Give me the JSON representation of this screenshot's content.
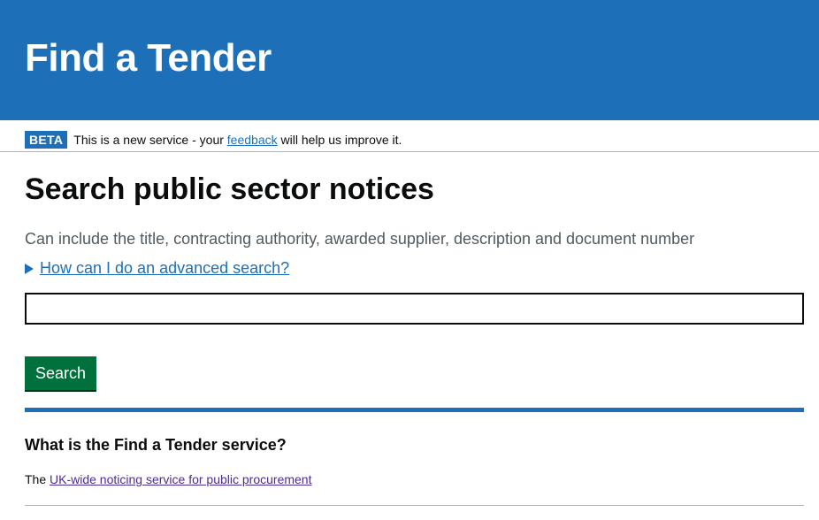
{
  "header": {
    "service_name": "Find a Tender"
  },
  "phase_banner": {
    "tag": "BETA",
    "text_before": "This is a new service - your ",
    "link_text": "feedback",
    "text_after": " will help us improve it."
  },
  "main": {
    "title": "Search public sector notices",
    "hint": "Can include the title, contracting authority, awarded supplier, description and document number",
    "advanced_search_link": "How can I do an advanced search?",
    "search_input": {
      "value": "",
      "placeholder": ""
    },
    "search_button": "Search"
  },
  "about": {
    "heading": "What is the Find a Tender service?",
    "text_before": "The ",
    "link_text": "UK-wide noticing service for public procurement"
  },
  "colors": {
    "brand_blue": "#1d70b8",
    "button_green": "#00703c",
    "visited_link": "#4c2c92"
  }
}
